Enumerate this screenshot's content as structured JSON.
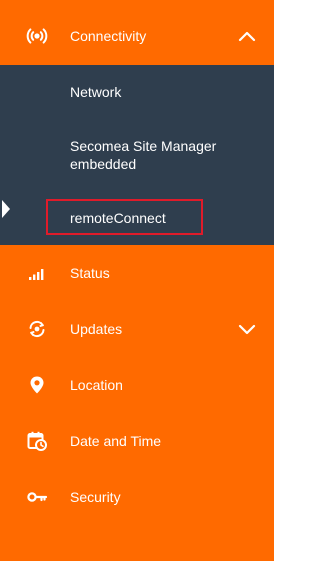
{
  "menu": {
    "connectivity": {
      "label": "Connectivity",
      "icon": "connectivity-icon",
      "expanded": true,
      "submenu": [
        {
          "label": "Network"
        },
        {
          "label": "Secomea Site Manager embedded"
        },
        {
          "label": "remoteConnect",
          "active": true
        }
      ]
    },
    "status": {
      "label": "Status",
      "icon": "signal-bars-icon"
    },
    "updates": {
      "label": "Updates",
      "icon": "sync-gear-icon",
      "expanded": false
    },
    "location": {
      "label": "Location",
      "icon": "location-pin-icon"
    },
    "date_time": {
      "label": "Date and Time",
      "icon": "calendar-clock-icon"
    },
    "security": {
      "label": "Security",
      "icon": "key-icon"
    }
  },
  "colors": {
    "menu_bg": "#ff6a00",
    "submenu_bg": "#2f3e4e",
    "text": "#ffffff",
    "highlight_border": "#e01b2a"
  }
}
